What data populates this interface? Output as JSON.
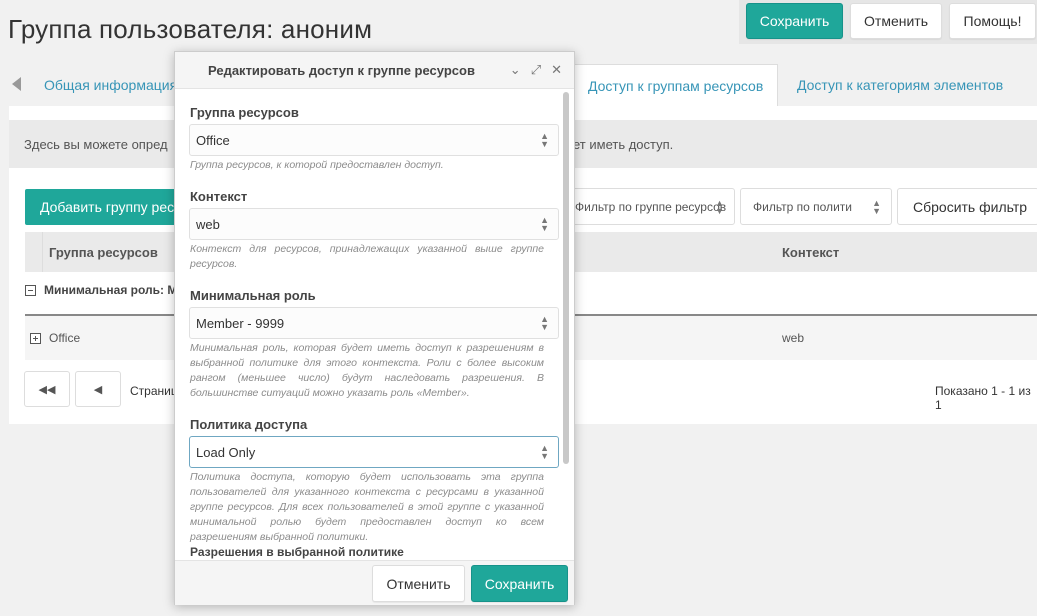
{
  "page": {
    "title": "Группа пользователя: аноним"
  },
  "toolbar": {
    "save_label": "Сохранить",
    "cancel_label": "Отменить",
    "help_label": "Помощь!"
  },
  "tabs": [
    {
      "label": "Общая информация"
    },
    {
      "label": "Доступ к группам ресурсов"
    },
    {
      "label": "Доступ к категориям элементов"
    }
  ],
  "main": {
    "notice_left": "Здесь вы можете опред",
    "notice_right": "ет иметь доступ.",
    "add_button": "Добавить группу ресурсов",
    "filter_group": "Фильтр по группе ресурсов",
    "filter_policy": "Фильтр по полити",
    "reset_filter": "Сбросить фильтр",
    "columns": {
      "resource_group": "Группа ресурсов",
      "context": "Контекст"
    },
    "group_row": "Минимальная роль: М",
    "row": {
      "name": "Office",
      "context": "web"
    },
    "pager_label": "Страниц",
    "shown_label": "Показано 1 - 1 из 1"
  },
  "modal": {
    "title": "Редактировать доступ к группе ресурсов",
    "fields": {
      "resource_group": {
        "label": "Группа ресурсов",
        "value": "Office",
        "help": "Группа ресурсов, к которой предоставлен доступ."
      },
      "context": {
        "label": "Контекст",
        "value": "web",
        "help": "Контекст для ресурсов, принадлежащих указанной выше группе ресурсов."
      },
      "min_role": {
        "label": "Минимальная роль",
        "value": "Member - 9999",
        "help": "Минимальная роль, которая будет иметь доступ к разрешениям в выбранной политике для этого контекста. Роли с более высоким рангом (меньшее число) будут наследовать разрешения. В большинстве ситуаций можно указать роль «Member»."
      },
      "policy": {
        "label": "Политика доступа",
        "value": "Load Only",
        "help": "Политика доступа, которую будет использовать эта группа пользователей для указанного контекста с ресурсами в указанной группе ресурсов. Для всех пользователей в этой группе с указанной минимальной ролью будет предоставлен доступ ко всем разрешениям выбранной политики."
      }
    },
    "permissions_title": "Разрешения в выбранной политике",
    "cancel_label": "Отменить",
    "save_label": "Сохранить"
  },
  "colors": {
    "accent": "#1fa79a",
    "link": "#3795b7"
  }
}
